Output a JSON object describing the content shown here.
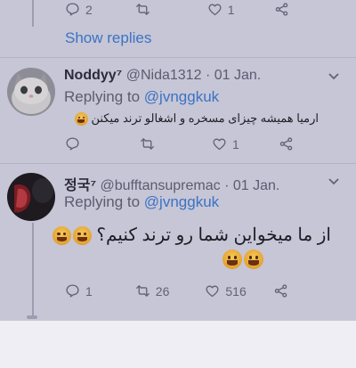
{
  "top_tweet": {
    "reply_count": "2",
    "like_count": "1",
    "show_replies_label": "Show replies"
  },
  "tweet1": {
    "display_name": "Noddyy⁷",
    "handle": "@Nida1312",
    "separator": "·",
    "date": "01 Jan.",
    "replying_prefix": "Replying to",
    "replying_to": "@jvnggkuk",
    "text": "ارمیا همیشه چیزای مسخره و اشغالو ترند میکنن",
    "like_count": "1"
  },
  "tweet2": {
    "display_name": "정국⁷",
    "handle": "@bufftansupremac",
    "separator": "·",
    "date": "01 Jan.",
    "replying_prefix": "Replying to",
    "replying_to": "@jvnggkuk",
    "text": "از ما میخواین شما رو ترند کنیم؟",
    "reply_count": "1",
    "retweet_count": "26",
    "like_count": "516"
  },
  "colors": {
    "background": "#c6c6d6",
    "link": "#3c72c4",
    "text_primary": "#1d1d26",
    "text_secondary": "#5a5c70"
  },
  "icons": [
    "reply-icon",
    "retweet-icon",
    "like-icon",
    "share-icon",
    "chevron-down-icon"
  ]
}
